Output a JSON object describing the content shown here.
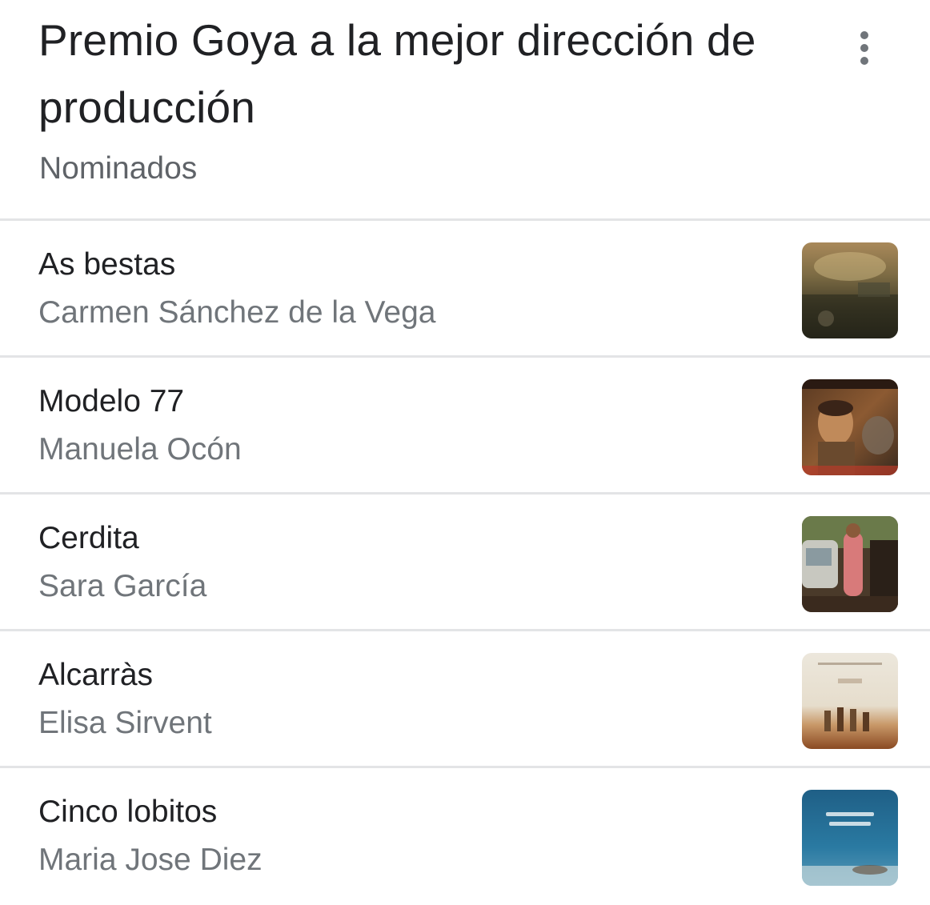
{
  "header": {
    "title": "Premio Goya a la mejor dirección de producción",
    "subtitle": "Nominados",
    "more_icon": "more-vert-icon"
  },
  "nominees": [
    {
      "film": "As bestas",
      "person": "Carmen Sánchez de la Vega",
      "poster": "film-poster-icon"
    },
    {
      "film": "Modelo 77",
      "person": "Manuela Ocón",
      "poster": "film-poster-icon"
    },
    {
      "film": "Cerdita",
      "person": "Sara García",
      "poster": "film-poster-icon"
    },
    {
      "film": "Alcarràs",
      "person": "Elisa Sirvent",
      "poster": "film-poster-icon"
    },
    {
      "film": "Cinco lobitos",
      "person": "Maria Jose Diez",
      "poster": "film-poster-icon"
    }
  ],
  "colors": {
    "title": "#202124",
    "secondary_text": "#70757a",
    "divider": "#e3e4e6"
  }
}
